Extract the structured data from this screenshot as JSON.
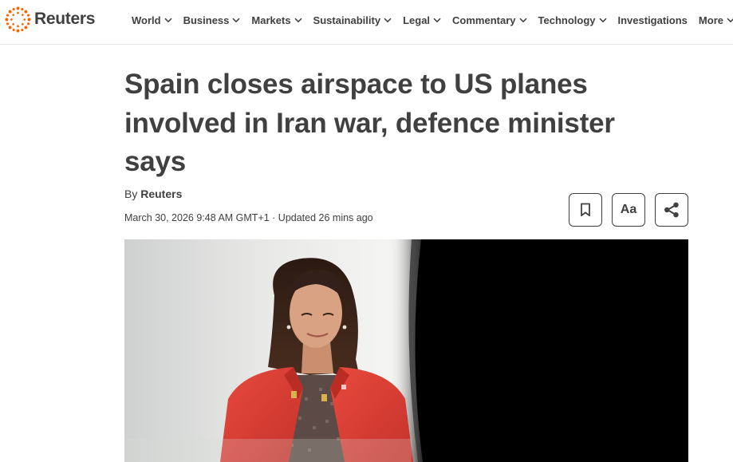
{
  "header": {
    "logo_text": "Reuters",
    "logo_icon": "reuters-dots-logo",
    "nav": [
      {
        "label": "World",
        "has_dropdown": true
      },
      {
        "label": "Business",
        "has_dropdown": true
      },
      {
        "label": "Markets",
        "has_dropdown": true
      },
      {
        "label": "Sustainability",
        "has_dropdown": true
      },
      {
        "label": "Legal",
        "has_dropdown": true
      },
      {
        "label": "Commentary",
        "has_dropdown": true
      },
      {
        "label": "Technology",
        "has_dropdown": true
      },
      {
        "label": "Investigations",
        "has_dropdown": false
      },
      {
        "label": "More",
        "has_dropdown": true
      }
    ]
  },
  "article": {
    "headline": "Spain closes airspace to US planes involved in Iran war, defence minister says",
    "byline_prefix": "By",
    "author": "Reuters",
    "dateline": "March 30, 2026 9:48 AM GMT+1 · Updated 26 mins ago",
    "tools": {
      "bookmark_icon": "bookmark-icon",
      "font_size_label": "Aa",
      "share_icon": "share-icon"
    }
  },
  "colors": {
    "text": "#404040",
    "brand_orange": "#fa6400",
    "photo_dark": "#000000"
  }
}
